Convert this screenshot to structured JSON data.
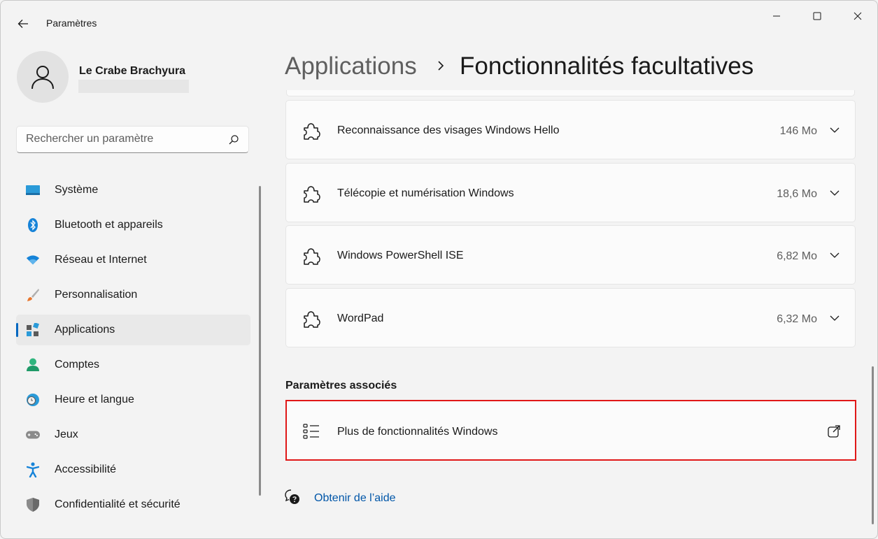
{
  "titlebar": {
    "app_title": "Paramètres",
    "back_icon": "back-arrow-icon",
    "minimize_icon": "minimize-icon",
    "maximize_icon": "maximize-icon",
    "close_icon": "close-icon"
  },
  "profile": {
    "name": "Le Crabe Brachyura",
    "avatar_icon": "person-icon"
  },
  "search": {
    "placeholder": "Rechercher un paramètre",
    "icon": "search-icon"
  },
  "nav": {
    "selected": "Applications",
    "items": [
      {
        "label": "Système",
        "icon": "system-display-icon"
      },
      {
        "label": "Bluetooth et appareils",
        "icon": "bluetooth-icon"
      },
      {
        "label": "Réseau et Internet",
        "icon": "wifi-icon"
      },
      {
        "label": "Personnalisation",
        "icon": "paintbrush-icon"
      },
      {
        "label": "Applications",
        "icon": "apps-icon"
      },
      {
        "label": "Comptes",
        "icon": "account-icon"
      },
      {
        "label": "Heure et langue",
        "icon": "globe-clock-icon"
      },
      {
        "label": "Jeux",
        "icon": "gamepad-icon"
      },
      {
        "label": "Accessibilité",
        "icon": "accessibility-icon"
      },
      {
        "label": "Confidentialité et sécurité",
        "icon": "shield-icon"
      }
    ]
  },
  "header": {
    "parent": "Applications",
    "separator_icon": "chevron-right-icon",
    "current": "Fonctionnalités facultatives"
  },
  "features": [
    {
      "name": "Reconnaissance des visages Windows Hello",
      "size": "146 Mo",
      "icon": "puzzle-icon"
    },
    {
      "name": "Télécopie et numérisation Windows",
      "size": "18,6 Mo",
      "icon": "puzzle-icon"
    },
    {
      "name": "Windows PowerShell ISE",
      "size": "6,82 Mo",
      "icon": "puzzle-icon"
    },
    {
      "name": "WordPad",
      "size": "6,32 Mo",
      "icon": "puzzle-icon"
    }
  ],
  "related": {
    "title": "Paramètres associés",
    "item": {
      "label": "Plus de fonctionnalités Windows",
      "icon": "list-icon",
      "action_icon": "external-link-icon"
    }
  },
  "help": {
    "label": "Obtenir de l’aide",
    "icon": "help-chat-icon"
  },
  "colors": {
    "accent": "#0067c0",
    "highlight_border": "#e01818",
    "link": "#0056a8"
  }
}
